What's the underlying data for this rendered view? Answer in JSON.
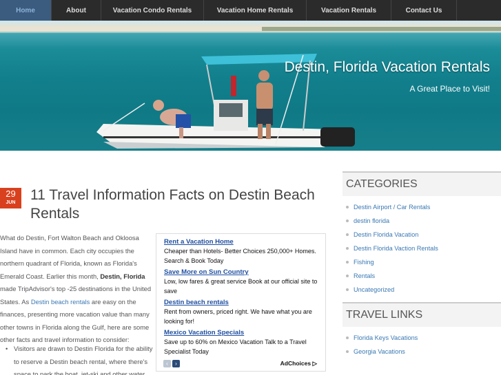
{
  "nav": {
    "items": [
      {
        "label": "Home",
        "active": true
      },
      {
        "label": "About"
      },
      {
        "label": "Vacation Condo Rentals"
      },
      {
        "label": "Vacation Home Rentals"
      },
      {
        "label": "Vacation Rentals"
      },
      {
        "label": "Contact Us"
      }
    ]
  },
  "header": {
    "title": "Destin, Florida Vacation Rentals",
    "subtitle": "A Great Place to Visit!"
  },
  "post": {
    "date_day": "29",
    "date_month": "JUN",
    "title": "11 Travel Information Facts on Destin Beach Rentals",
    "p1": "What do Destin, Fort Walton Beach and Okloosa Island have in common.  Each city occupies the northern quadrant of Florida, known as Florida's Emerald Coast. Earlier this month, ",
    "p1_bold": "Destin, Florida",
    "p2": " made TripAdvisor's top -25  destinations in the United States. As ",
    "p2_link": "Destin beach rentals",
    "p3": " are easy on the finances, presenting more vacation value than many other towns in Florida along the Gulf, here are some other facts and travel information to consider:",
    "bullet1": "Visitors are drawn to Destin Florida for the ability to reserve a Destin beach rental,  where there's space to park the boat, jet-ski and other water"
  },
  "ads": {
    "items": [
      {
        "title": "Rent a Vacation Home",
        "text": "Cheaper than Hotels- Better Choices 250,000+ Homes. Search & Book Today"
      },
      {
        "title": "Save More on Sun Country",
        "text": "Low, low fares & great service Book at our official site to save"
      },
      {
        "title": "Destin beach rentals",
        "text": "Rent from owners, priced right. We have what you are looking for!"
      },
      {
        "title": "Mexico Vacation Specials",
        "text": "Save up to 60% on Mexico Vacation Talk to a Travel Specialist Today"
      }
    ],
    "adchoices": "AdChoices",
    "prev_icon": "‹",
    "next_icon": "›"
  },
  "sidebar": {
    "categories_title": "CATEGORIES",
    "categories": [
      "Destin Airport / Car Rentals",
      "destin florida",
      "Destin Florida Vacation",
      "Destin Florida Vaction Rentals",
      "Fishing",
      "Rentals",
      "Uncategorized"
    ],
    "travel_title": "TRAVEL LINKS",
    "travel": [
      "Florida Keys Vacations",
      "Georgia Vacations"
    ]
  },
  "colors": {
    "nav_bg": "#2b2b2b",
    "nav_active": "#3b5b7f",
    "accent": "#d9411e",
    "link": "#3a78b3"
  }
}
